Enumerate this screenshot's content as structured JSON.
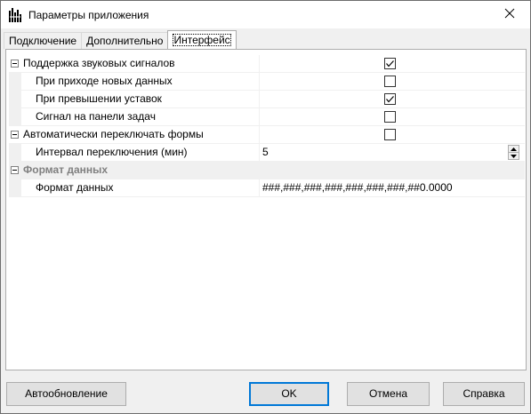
{
  "window": {
    "title": "Параметры приложения"
  },
  "tabs": [
    {
      "label": "Подключение",
      "active": false
    },
    {
      "label": "Дополнительно",
      "active": false
    },
    {
      "label": "Интерфейс",
      "active": true
    }
  ],
  "grid": {
    "rows": [
      {
        "name": "Поддержка звуковых сигналов",
        "type": "checkbox",
        "checked": true,
        "level": 0,
        "expander": true
      },
      {
        "name": "При приходе новых данных",
        "type": "checkbox",
        "checked": false,
        "level": 1
      },
      {
        "name": "При превышении уставок",
        "type": "checkbox",
        "checked": true,
        "level": 1
      },
      {
        "name": "Сигнал на панели задач",
        "type": "checkbox",
        "checked": false,
        "level": 1
      },
      {
        "name": "Автоматически переключать формы",
        "type": "checkbox",
        "checked": false,
        "level": 0,
        "expander": true
      },
      {
        "name": "Интервал переключения (мин)",
        "type": "spinner",
        "value": "5",
        "level": 1
      },
      {
        "name": "Формат данных",
        "type": "category",
        "expander": true
      },
      {
        "name": "Формат данных",
        "type": "text",
        "value": "###,###,###,###,###,###,###,##0.0000",
        "level": 1
      }
    ]
  },
  "buttons": {
    "auto_update": "Автообновление",
    "ok": "OK",
    "cancel": "Отмена",
    "help": "Справка"
  },
  "icons": {
    "app": "app-icon",
    "close": "close-icon",
    "expander": "collapse-icon",
    "check": "checkmark-icon",
    "spin_up": "arrow-up-icon",
    "spin_down": "arrow-down-icon"
  },
  "colors": {
    "accent": "#0078d7",
    "dialog_bg": "#f0f0f0",
    "category_text": "#808080"
  }
}
